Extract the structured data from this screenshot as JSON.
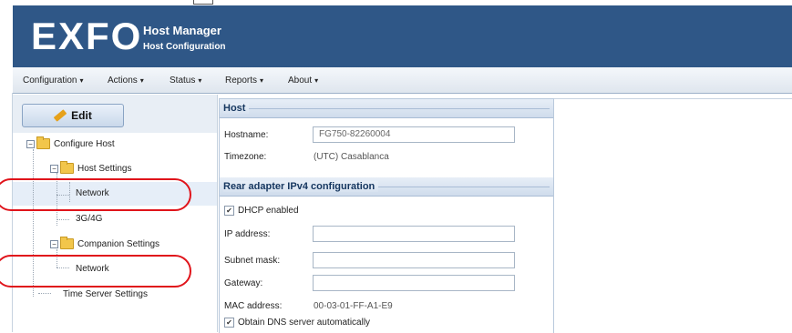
{
  "header": {
    "logo": "EXFO",
    "title": "Host Manager",
    "subtitle": "Host Configuration",
    "brand_color": "#2f5787"
  },
  "menu": [
    {
      "label": "Configuration",
      "caret": "▾"
    },
    {
      "label": "Actions",
      "caret": "▾"
    },
    {
      "label": "Status",
      "caret": "▾"
    },
    {
      "label": "Reports",
      "caret": "▾"
    },
    {
      "label": "About",
      "caret": "▾"
    }
  ],
  "left_panel": {
    "edit_label": "Edit",
    "tree": {
      "root": "Configure Host",
      "host_settings": "Host Settings",
      "host_network": "Network",
      "host_3g4g": "3G/4G",
      "companion_settings": "Companion Settings",
      "companion_network": "Network",
      "time_server": "Time Server Settings"
    }
  },
  "host_section": {
    "header": "Host",
    "hostname_label": "Hostname:",
    "hostname_value": "FG750-82260004",
    "timezone_label": "Timezone:",
    "timezone_value": "(UTC) Casablanca"
  },
  "rear_section": {
    "header": "Rear adapter IPv4 configuration",
    "dhcp_label": "DHCP enabled",
    "dhcp_checked": true,
    "ip_label": "IP address:",
    "ip_value": "",
    "subnet_label": "Subnet mask:",
    "subnet_value": "",
    "gateway_label": "Gateway:",
    "gateway_value": "",
    "mac_label": "MAC address:",
    "mac_value": "00-03-01-FF-A1-E9",
    "dns_label": "Obtain DNS server automatically",
    "dns_checked": true
  },
  "annotation_color": "#e0141b"
}
